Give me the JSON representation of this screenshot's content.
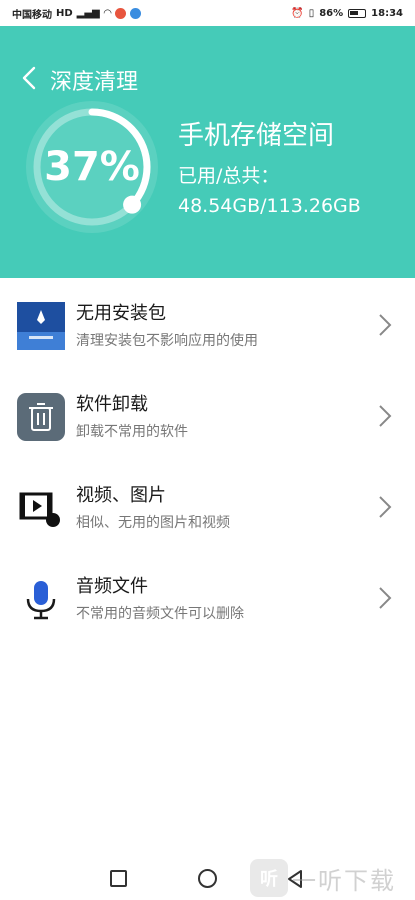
{
  "status_bar": {
    "carrier": "中国移动",
    "network": "HD",
    "battery": "86%",
    "time": "18:34"
  },
  "header": {
    "title": "深度清理",
    "percent": "37%",
    "percent_value": 0.37,
    "storage_title": "手机存储空间",
    "storage_detail": "已用/总共：48.54GB/113.26GB",
    "accent_color": "#45cbb8"
  },
  "items": [
    {
      "title": "无用安装包",
      "desc": "清理安装包不影响应用的使用",
      "icon": "package-thumbnail-icon"
    },
    {
      "title": "软件卸载",
      "desc": "卸载不常用的软件",
      "icon": "trash-icon"
    },
    {
      "title": "视频、图片",
      "desc": "相似、无用的图片和视频",
      "icon": "video-image-icon"
    },
    {
      "title": "音频文件",
      "desc": "不常用的音频文件可以删除",
      "icon": "microphone-icon"
    }
  ],
  "watermark": {
    "badge": "听",
    "text": "一听下载"
  }
}
